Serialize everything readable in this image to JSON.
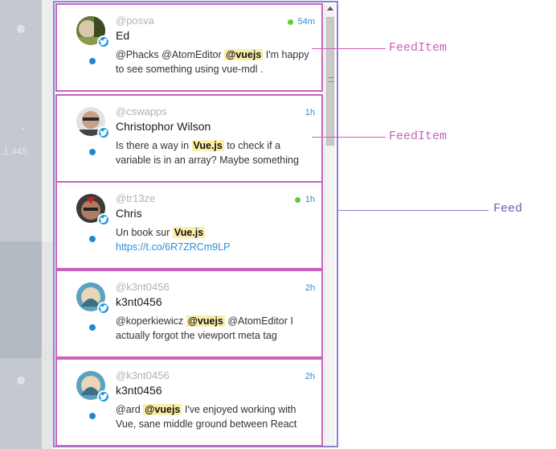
{
  "background": {
    "count_text": "1,445"
  },
  "annotations": {
    "feed_item_label_1": "FeedItem",
    "feed_item_label_2": "FeedItem",
    "feed_label": "Feed"
  },
  "colors": {
    "feed_item_border": "#c862bb",
    "feed_border": "#8a80d0",
    "twitter_blue": "#1e9be9",
    "online_green": "#66cc33",
    "highlight": "#fbeeaa"
  },
  "feed": {
    "items": [
      {
        "handle": "@posva",
        "name": "Ed",
        "time": "54m",
        "online": true,
        "body": [
          {
            "t": "@Phacks @AtomEditor "
          },
          {
            "t": "@vuejs",
            "hl": true
          },
          {
            "t": " I'm happy to see something using vue-mdl ."
          }
        ]
      },
      {
        "handle": "@cswapps",
        "name": "Christophor Wilson",
        "time": "1h",
        "online": false,
        "body": [
          {
            "t": "Is there a way in "
          },
          {
            "t": "Vue.js",
            "hl": true
          },
          {
            "t": " to check if a variable is in an array? Maybe something"
          }
        ]
      },
      {
        "handle": "@tr13ze",
        "name": "Chris",
        "time": "1h",
        "online": true,
        "body": [
          {
            "t": "Un book sur "
          },
          {
            "t": "Vue.js",
            "hl": true
          },
          {
            "t": " "
          },
          {
            "t": "https://t.co/6R7ZRCm9LP",
            "link": true
          }
        ]
      },
      {
        "handle": "@k3nt0456",
        "name": "k3nt0456",
        "time": "2h",
        "online": false,
        "body": [
          {
            "t": "@koperkiewicz "
          },
          {
            "t": "@vuejs",
            "hl": true
          },
          {
            "t": " @AtomEditor I actually forgot the viewport meta tag"
          }
        ]
      },
      {
        "handle": "@k3nt0456",
        "name": "k3nt0456",
        "time": "2h",
        "online": false,
        "body": [
          {
            "t": "@ard "
          },
          {
            "t": "@vuejs",
            "hl": true
          },
          {
            "t": " I've enjoyed working with Vue, sane middle ground between React"
          }
        ]
      }
    ]
  }
}
